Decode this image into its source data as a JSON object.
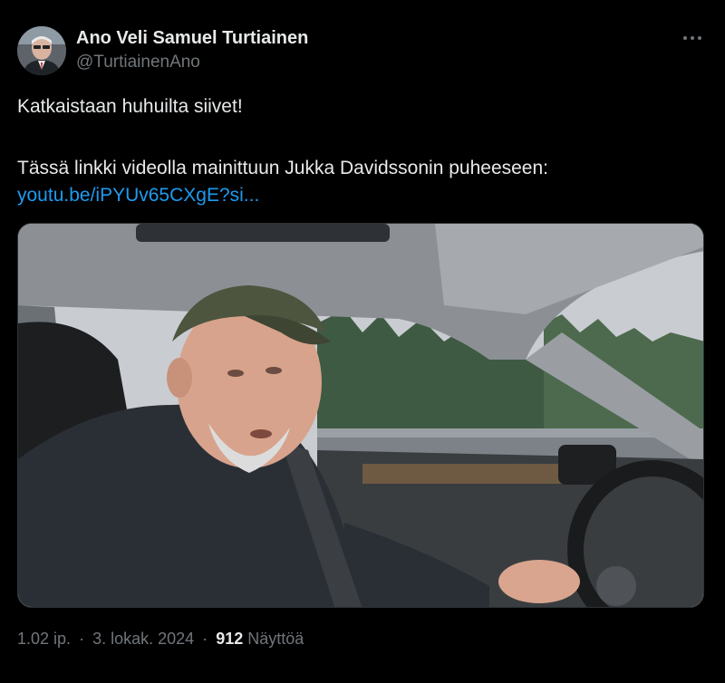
{
  "author": {
    "display_name": "Ano Veli Samuel Turtiainen",
    "handle": "@TurtiainenAno"
  },
  "post": {
    "line1": "Katkaistaan huhuilta siivet!",
    "line2": "Tässä linkki videolla mainittuun Jukka Davidssonin puheeseen:",
    "link_text": "youtu.be/iPYUv65CXgE?si..."
  },
  "media": {
    "icon": "video-thumbnail"
  },
  "footer": {
    "time": "1.02 ip.",
    "separator": "·",
    "date": "3. lokak. 2024",
    "views_count": "912",
    "views_label": "Näyttöä"
  },
  "icons": {
    "more": "more-horizontal-icon"
  },
  "colors": {
    "background": "#000000",
    "text": "#e7e9ea",
    "secondary": "#71767b",
    "link": "#1d9bf0"
  }
}
